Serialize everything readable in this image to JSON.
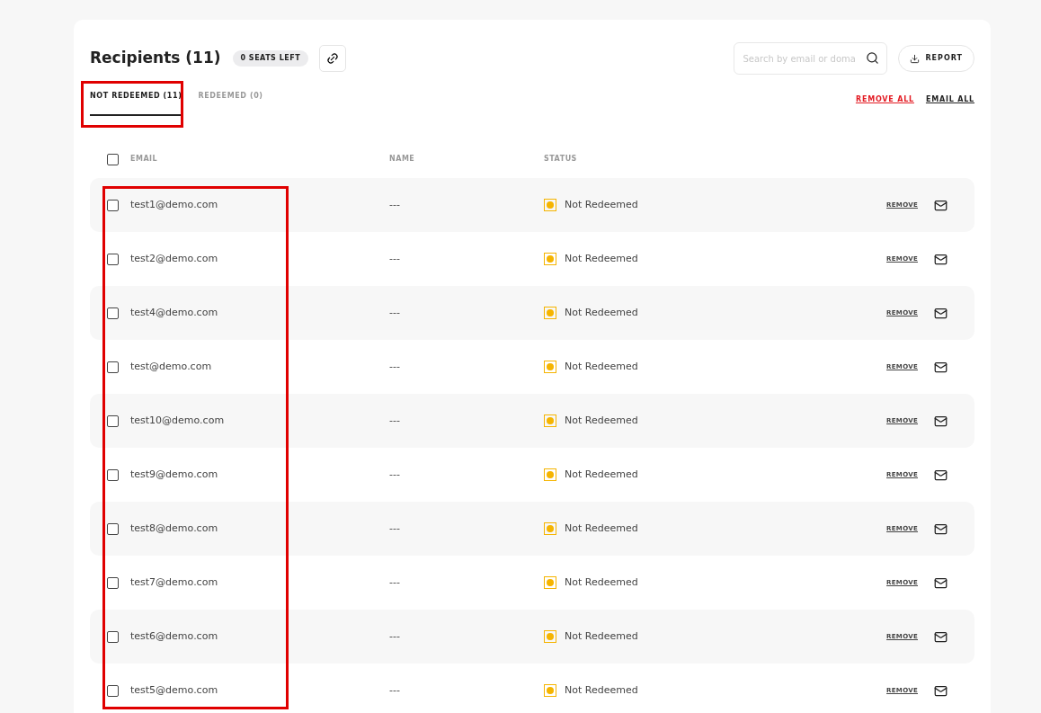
{
  "header": {
    "title": "Recipients (11)",
    "seats_badge": "0 SEATS LEFT",
    "search": {
      "placeholder": "Search by email or doma"
    },
    "report_button": "REPORT"
  },
  "tabs": [
    {
      "label": "NOT REDEEMED (11)",
      "selected": true
    },
    {
      "label": "REDEEMED (0)",
      "selected": false
    }
  ],
  "actions": {
    "remove_all": "REMOVE ALL",
    "email_all": "EMAIL ALL"
  },
  "table": {
    "columns": [
      "EMAIL",
      "NAME",
      "STATUS"
    ],
    "select_all_checked": false,
    "rows": [
      {
        "email": "test1@demo.com",
        "name": "---",
        "status": "Not Redeemed",
        "color": "#f5b400",
        "checked": false,
        "remove": "REMOVE"
      },
      {
        "email": "test2@demo.com",
        "name": "---",
        "status": "Not Redeemed",
        "color": "#f5b400",
        "checked": false,
        "remove": "REMOVE"
      },
      {
        "email": "test4@demo.com",
        "name": "---",
        "status": "Not Redeemed",
        "color": "#f5b400",
        "checked": false,
        "remove": "REMOVE"
      },
      {
        "email": "test@demo.com",
        "name": "---",
        "status": "Not Redeemed",
        "color": "#f5b400",
        "checked": false,
        "remove": "REMOVE"
      },
      {
        "email": "test10@demo.com",
        "name": "---",
        "status": "Not Redeemed",
        "color": "#f5b400",
        "checked": false,
        "remove": "REMOVE"
      },
      {
        "email": "test9@demo.com",
        "name": "---",
        "status": "Not Redeemed",
        "color": "#f5b400",
        "checked": false,
        "remove": "REMOVE"
      },
      {
        "email": "test8@demo.com",
        "name": "---",
        "status": "Not Redeemed",
        "color": "#f5b400",
        "checked": false,
        "remove": "REMOVE"
      },
      {
        "email": "test7@demo.com",
        "name": "---",
        "status": "Not Redeemed",
        "color": "#f5b400",
        "checked": false,
        "remove": "REMOVE"
      },
      {
        "email": "test6@demo.com",
        "name": "---",
        "status": "Not Redeemed",
        "color": "#f5b400",
        "checked": false,
        "remove": "REMOVE"
      },
      {
        "email": "test5@demo.com",
        "name": "---",
        "status": "Not Redeemed",
        "color": "#f5b400",
        "checked": false,
        "remove": "REMOVE"
      }
    ]
  }
}
